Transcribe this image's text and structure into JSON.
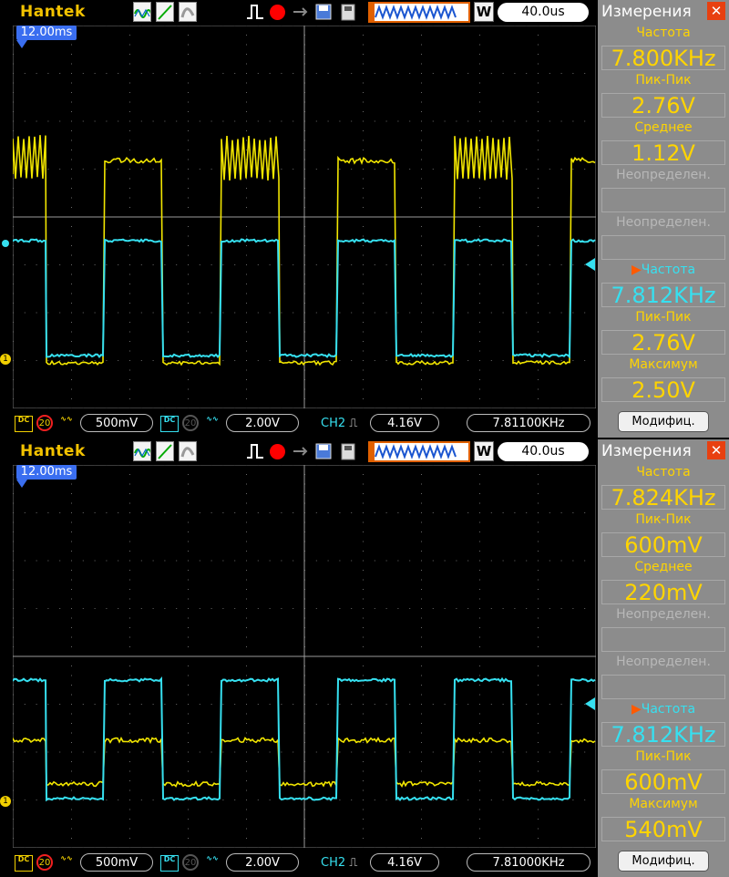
{
  "colors": {
    "ch1": "#f2e600",
    "ch2": "#36e0f0",
    "grid": "#7a7a7a"
  },
  "icons": [
    "ch1-dc-icon",
    "bw-limit-icon",
    "ch2-dc-icon",
    "edge-rising-icon",
    "record-icon",
    "save-icon",
    "usb-icon",
    "waveform-icon",
    "close-icon"
  ],
  "panels": [
    {
      "logo": "Hantek",
      "timebase": "40.0us",
      "window_label": "W",
      "trigger_pos": "12.00ms",
      "ch1_scale": "500mV",
      "ch1_bw": "20",
      "ch2_scale": "2.00V",
      "ch2_bw": "20",
      "trigger_source": "CH2",
      "trigger_level": "4.16V",
      "counter": "7.81100KHz",
      "side": {
        "title": "Измерения",
        "m1_label": "Частота",
        "m1_value": "7.800KHz",
        "m2_label": "Пик-Пик",
        "m2_value": "2.76V",
        "m3_label": "Среднее",
        "m3_value": "1.12V",
        "m4_label": "Неопределен.",
        "m5_label": "Неопределен.",
        "m6_label": "Частота",
        "m6_value": "7.812KHz",
        "m7_label": "Пик-Пик",
        "m7_value": "2.76V",
        "m8_label": "Максимум",
        "m8_value": "2.50V",
        "modify_button": "Модифиц."
      }
    },
    {
      "logo": "Hantek",
      "timebase": "40.0us",
      "window_label": "W",
      "trigger_pos": "12.00ms",
      "ch1_scale": "500mV",
      "ch1_bw": "20",
      "ch2_scale": "2.00V",
      "ch2_bw": "20",
      "trigger_source": "CH2",
      "trigger_level": "4.16V",
      "counter": "7.81000KHz",
      "side": {
        "title": "Измерения",
        "m1_label": "Частота",
        "m1_value": "7.824KHz",
        "m2_label": "Пик-Пик",
        "m2_value": "600mV",
        "m3_label": "Среднее",
        "m3_value": "220mV",
        "m4_label": "Неопределен.",
        "m5_label": "Неопределен.",
        "m6_label": "Частота",
        "m6_value": "7.812KHz",
        "m7_label": "Пик-Пик",
        "m7_value": "600mV",
        "m8_label": "Максимум",
        "m8_value": "540mV",
        "modify_button": "Модифиц."
      }
    }
  ]
}
